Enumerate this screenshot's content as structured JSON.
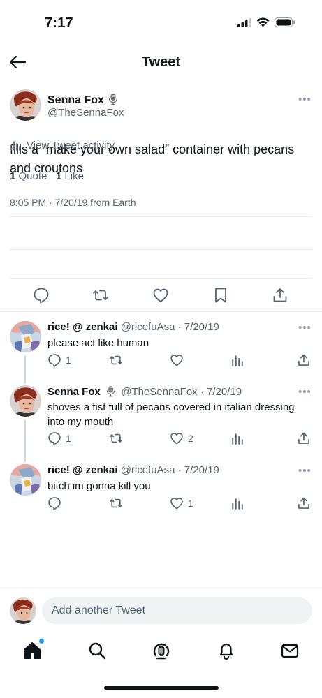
{
  "status_bar": {
    "time": "7:17"
  },
  "header": {
    "title": "Tweet"
  },
  "main_tweet": {
    "name": "Senna Fox",
    "handle": "@TheSennaFox",
    "text": "fills a “make your own salad” container with pecans and croutons",
    "meta": "8:05 PM · 7/20/19 from Earth",
    "activity_label": "View Tweet activity",
    "quote_count": "1",
    "quote_label": "Quote",
    "like_count": "1",
    "like_label": "Like"
  },
  "replies": [
    {
      "name": "rice! @ zenkai",
      "handle": "@ricefuAsa",
      "date": "· 7/20/19",
      "text": "please act like human",
      "reply_count": "1",
      "retweet_count": "",
      "like_count": ""
    },
    {
      "name": "Senna Fox",
      "handle": "@TheSennaFox",
      "date": "· 7/20/19",
      "text": "shoves a fist full of pecans covered in italian dressing into my mouth",
      "reply_count": "1",
      "retweet_count": "",
      "like_count": "2"
    },
    {
      "name": "rice! @ zenkai",
      "handle": "@ricefuAsa",
      "date": "· 7/20/19",
      "text": "bitch im gonna kill you",
      "reply_count": "",
      "retweet_count": "",
      "like_count": "1"
    }
  ],
  "compose": {
    "placeholder": "Add another Tweet"
  },
  "colors": {
    "accent": "#1d9bf0",
    "text": "#0f1419",
    "secondary": "#536471",
    "divider": "#e7e9ea"
  },
  "icons": [
    "back-arrow-icon",
    "reply-icon",
    "retweet-icon",
    "like-icon",
    "bookmark-icon",
    "share-icon",
    "analytics-icon",
    "home-icon",
    "search-icon",
    "spaces-icon",
    "bell-icon",
    "mail-icon"
  ]
}
